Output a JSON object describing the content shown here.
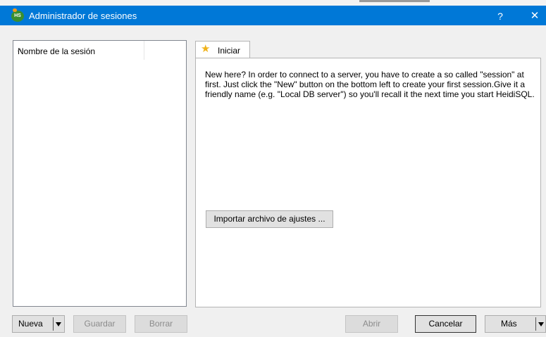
{
  "window": {
    "title": "Administrador de sesiones",
    "app_icon_text": "HS",
    "help_label": "?",
    "close_label": "✕"
  },
  "session_list": {
    "column_header": "Nombre de la sesión",
    "sort_glyph": "^"
  },
  "tabs": [
    {
      "label": "Iniciar",
      "icon": "star-icon",
      "icon_glyph": "★",
      "selected": true
    }
  ],
  "start_tab": {
    "intro_text": "New here? In order to connect to a server, you have to create a so called \"session\" at first. Just click the \"New\" button on the bottom left to create your first session.Give it a friendly name (e.g. \"Local DB server\") so you'll recall it the next time you start HeidiSQL.",
    "import_button": "Importar archivo de ajustes ..."
  },
  "buttons": {
    "new": "Nueva",
    "save": "Guardar",
    "delete": "Borrar",
    "open": "Abrir",
    "cancel": "Cancelar",
    "more": "Más"
  },
  "colors": {
    "titlebar": "#0078d7",
    "star": "#f0b21a",
    "app_icon": "#3a8f2f"
  }
}
